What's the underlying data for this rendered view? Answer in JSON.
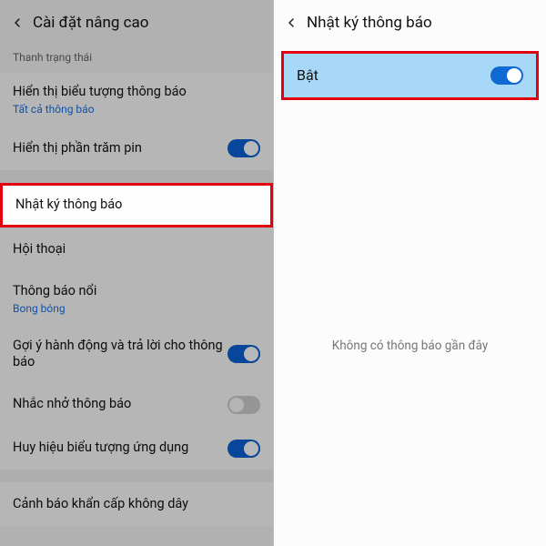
{
  "left": {
    "header_title": "Cài đặt nâng cao",
    "section_label": "Thanh trạng thái",
    "rows": {
      "show_icons": {
        "title": "Hiển thị biểu tượng thông báo",
        "sub": "Tất cả thông báo"
      },
      "battery_pct": {
        "title": "Hiển thị phần trăm pin"
      },
      "notif_log": {
        "title": "Nhật ký thông báo"
      },
      "conversation": {
        "title": "Hội thoại"
      },
      "bubble": {
        "title": "Thông báo nổi",
        "sub": "Bong bóng"
      },
      "suggest": {
        "title": "Gợi ý hành động và trả lời cho thông báo"
      },
      "remind": {
        "title": "Nhắc nhở thông báo"
      },
      "badge": {
        "title": "Huy hiệu biểu tượng ứng dụng"
      },
      "emergency": {
        "title": "Cảnh báo khẩn cấp không dây"
      }
    }
  },
  "right": {
    "header_title": "Nhật ký thông báo",
    "toggle_label": "Bật",
    "empty_message": "Không có thông báo gần đây"
  }
}
